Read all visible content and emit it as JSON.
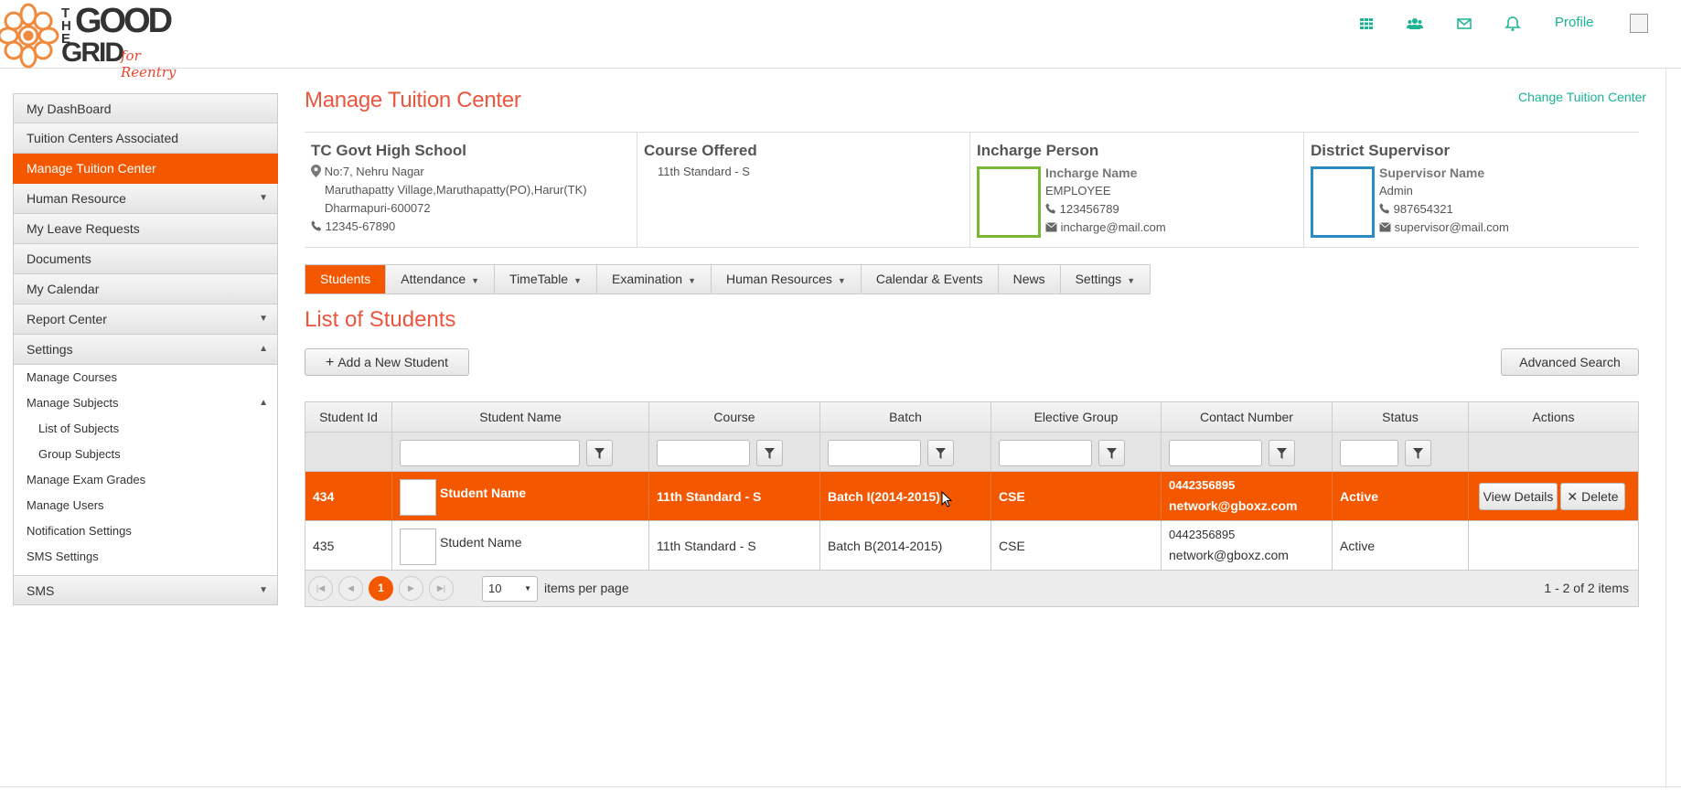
{
  "header": {
    "logo": {
      "the": "THE",
      "good": "GOOD",
      "grid": "GRID",
      "reentry": "for Reentry"
    },
    "icons": [
      "apps-grid-icon",
      "users-icon",
      "envelope-icon",
      "bell-icon"
    ],
    "profile_label": "Profile"
  },
  "sidebar": {
    "items": [
      {
        "label": "My DashBoard"
      },
      {
        "label": "Tuition Centers Associated"
      },
      {
        "label": "Manage Tuition Center",
        "active": true
      },
      {
        "label": "Human Resource",
        "arrow": "▼"
      },
      {
        "label": "My Leave Requests"
      },
      {
        "label": "Documents"
      },
      {
        "label": "My Calendar"
      },
      {
        "label": "Report Center",
        "arrow": "▼"
      },
      {
        "label": "Settings",
        "arrow": "▲"
      }
    ],
    "settings_sub": [
      {
        "label": "Manage Courses"
      },
      {
        "label": "Manage Subjects",
        "arrow": "▲"
      },
      {
        "label": "List of Subjects"
      },
      {
        "label": "Group Subjects"
      },
      {
        "label": "Manage Exam Grades"
      },
      {
        "label": "Manage Users"
      },
      {
        "label": "Notification Settings"
      },
      {
        "label": "SMS Settings"
      }
    ],
    "sms": {
      "label": "SMS",
      "arrow": "▼"
    }
  },
  "page": {
    "title": "Manage Tuition Center",
    "change_link": "Change Tuition Center"
  },
  "info": {
    "school": {
      "name": "TC Govt High School",
      "addr1": "No:7, Nehru Nagar",
      "addr2": "Maruthapatty Village,Maruthapatty(PO),Harur(TK)",
      "addr3": "Dharmapuri-600072",
      "phone": "12345-67890"
    },
    "course": {
      "heading": "Course Offered",
      "value": "11th Standard - S"
    },
    "incharge": {
      "heading": "Incharge Person",
      "name": "Incharge Name",
      "role": "EMPLOYEE",
      "phone": "123456789",
      "email": "incharge@mail.com",
      "border": "#7ab833"
    },
    "supervisor": {
      "heading": "District Supervisor",
      "name": "Supervisor Name",
      "role": "Admin",
      "phone": "987654321",
      "email": "supervisor@mail.com",
      "border": "#2a8ac4"
    }
  },
  "tabs": [
    {
      "label": "Students",
      "active": true
    },
    {
      "label": "Attendance",
      "dd": "▼"
    },
    {
      "label": "TimeTable",
      "dd": "▼"
    },
    {
      "label": "Examination",
      "dd": "▼"
    },
    {
      "label": "Human Resources",
      "dd": "▼"
    },
    {
      "label": "Calendar & Events"
    },
    {
      "label": "News"
    },
    {
      "label": "Settings",
      "dd": "▼"
    }
  ],
  "list": {
    "title": "List of Students",
    "add_button": "Add a New Student",
    "advanced_search": "Advanced Search"
  },
  "grid": {
    "columns": [
      "Student Id",
      "Student Name",
      "Course",
      "Batch",
      "Elective Group",
      "Contact Number",
      "Status",
      "Actions"
    ],
    "rows": [
      {
        "id": "434",
        "name": "Student Name",
        "course": "11th Standard - S",
        "batch": "Batch I(2014-2015)",
        "group": "CSE",
        "phone": "0442356895",
        "email": "network@gboxz.com",
        "status": "Active",
        "selected": true,
        "view_label": "View Details",
        "delete_label": "Delete"
      },
      {
        "id": "435",
        "name": "Student Name",
        "course": "11th Standard - S",
        "batch": "Batch B(2014-2015)",
        "group": "CSE",
        "phone": "0442356895",
        "email": "network@gboxz.com",
        "status": "Active",
        "selected": false
      }
    ],
    "pager": {
      "current_page": "1",
      "page_size": "10",
      "per_page_label": "items per page",
      "summary": "1 - 2 of 2 items"
    }
  },
  "colors": {
    "accent": "#f35800",
    "title": "#e9573f",
    "link": "#1ab394"
  }
}
